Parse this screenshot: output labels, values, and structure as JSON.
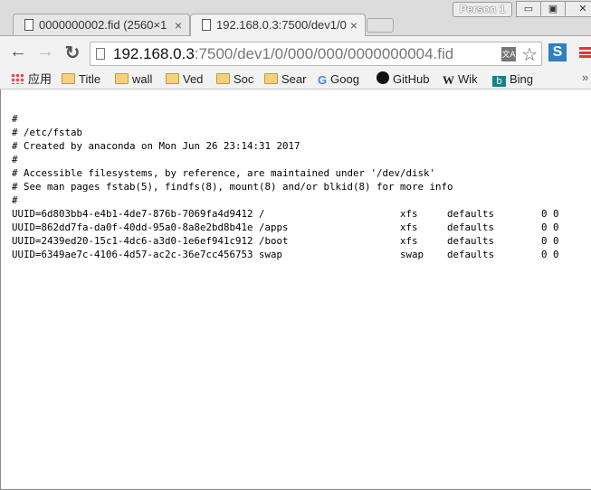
{
  "window": {
    "profile": "Person 1",
    "minimize": "▭",
    "restore": "▣",
    "close": "✕"
  },
  "tabs": [
    {
      "title": "0000000002.fid (2560×1",
      "active": false
    },
    {
      "title": "192.168.0.3:7500/dev1/0",
      "active": true
    }
  ],
  "toolbar": {
    "back": "←",
    "forward": "→",
    "reload": "↻",
    "url_host": "192.168.0.3",
    "url_path": ":7500/dev1/0/000/000/0000000004.fid",
    "translate": "文A",
    "star": "☆",
    "extension": "S"
  },
  "bookmarks": [
    {
      "label": "应用",
      "icon": "apps-grid-icon"
    },
    {
      "label": "Title",
      "icon": "folder-icon"
    },
    {
      "label": "wall",
      "icon": "folder-icon"
    },
    {
      "label": "Ved",
      "icon": "folder-icon"
    },
    {
      "label": "Soc",
      "icon": "folder-icon"
    },
    {
      "label": "Sear",
      "icon": "folder-icon"
    },
    {
      "label": "Goog",
      "icon": "google-icon"
    },
    {
      "label": "GitHub",
      "icon": "github-icon"
    },
    {
      "label": "Wik",
      "icon": "wikipedia-icon"
    },
    {
      "label": "Bing",
      "icon": "bing-icon"
    }
  ],
  "bookmarks_more": "»",
  "content": {
    "comments": [
      "#",
      "# /etc/fstab",
      "# Created by anaconda on Mon Jun 26 23:14:31 2017",
      "#",
      "# Accessible filesystems, by reference, are maintained under '/dev/disk'",
      "# See man pages fstab(5), findfs(8), mount(8) and/or blkid(8) for more info",
      "#"
    ],
    "entries": [
      [
        "UUID=6d803bb4-e4b1-4de7-876b-7069fa4d9412",
        "/",
        "xfs",
        "defaults",
        "0 0"
      ],
      [
        "UUID=862dd7fa-da0f-40dd-95a0-8a8e2bd8b41e",
        "/apps",
        "xfs",
        "defaults",
        "0 0"
      ],
      [
        "UUID=2439ed20-15c1-4dc6-a3d0-1e6ef941c912",
        "/boot",
        "xfs",
        "defaults",
        "0 0"
      ],
      [
        "UUID=6349ae7c-4106-4d57-ac2c-36e7cc456753",
        "swap",
        "swap",
        "defaults",
        "0 0"
      ]
    ]
  }
}
